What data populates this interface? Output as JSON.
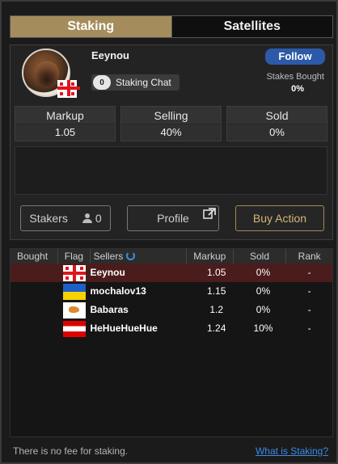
{
  "tabs": [
    {
      "label": "Staking",
      "active": true
    },
    {
      "label": "Satellites",
      "active": false
    }
  ],
  "profile": {
    "name": "Eeynou",
    "chat_count": "0",
    "chat_label": "Staking Chat",
    "follow_label": "Follow",
    "stakes_bought_label": "Stakes Bought",
    "stakes_bought_value": "0%",
    "flag": "georgia-flag-icon"
  },
  "stats": {
    "markup_label": "Markup",
    "markup_value": "1.05",
    "selling_label": "Selling",
    "selling_value": "40%",
    "sold_label": "Sold",
    "sold_value": "0%"
  },
  "actions": {
    "stakers_label": "Stakers",
    "stakers_count": "0",
    "profile_label": "Profile",
    "buy_label": "Buy Action"
  },
  "table": {
    "headers": {
      "bought": "Bought",
      "flag": "Flag",
      "sellers": "Sellers",
      "markup": "Markup",
      "sold": "Sold",
      "rank": "Rank"
    },
    "rows": [
      {
        "bought": "",
        "flag": "georgia",
        "seller": "Eeynou",
        "markup": "1.05",
        "sold": "0%",
        "rank": "-"
      },
      {
        "bought": "",
        "flag": "ukraine",
        "seller": "mochalov13",
        "markup": "1.15",
        "sold": "0%",
        "rank": "-"
      },
      {
        "bought": "",
        "flag": "cyprus",
        "seller": "Babaras",
        "markup": "1.2",
        "sold": "0%",
        "rank": "-"
      },
      {
        "bought": "",
        "flag": "austria",
        "seller": "HeHueHueHue",
        "markup": "1.24",
        "sold": "10%",
        "rank": "-"
      }
    ]
  },
  "footer": {
    "note": "There is no fee for staking.",
    "link": "What is Staking?"
  },
  "colors": {
    "tab_active": "#a48c5c",
    "follow": "#2d5aa8",
    "selected_row": "#4b1c1c",
    "buy_accent": "#d6b679",
    "link": "#3b8be6"
  }
}
